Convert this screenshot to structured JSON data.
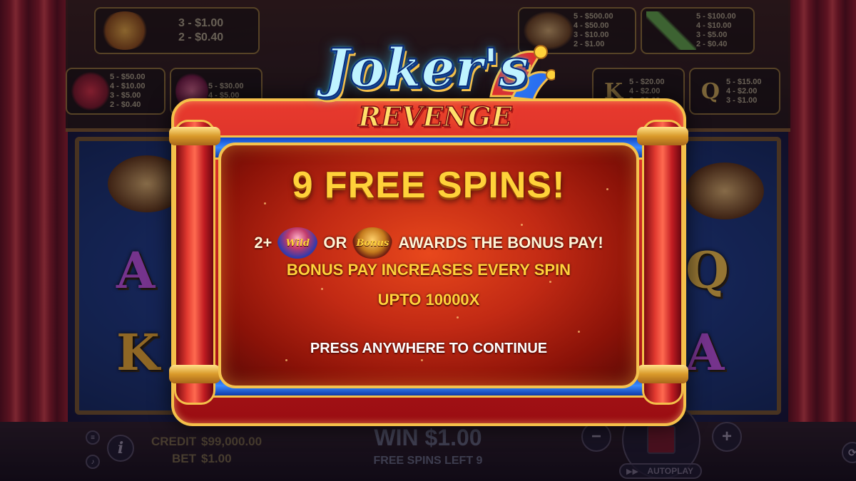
{
  "paytable": {
    "bonus_values": [
      "3 - $1.00",
      "2 - $0.40"
    ],
    "chicken_values": [
      "5 - $500.00",
      "4 - $50.00",
      "3 - $10.00",
      "2 - $1.00"
    ],
    "pins_values": [
      "5 - $100.00",
      "4 - $10.00",
      "3 - $5.00",
      "2 - $0.40"
    ],
    "crown_values": [
      "5 - $50.00",
      "4 - $10.00",
      "3 - $5.00",
      "2 - $0.40"
    ],
    "gem_values": [
      "5 - $30.00",
      "4 - $5.00"
    ],
    "k_values": [
      "5 - $20.00",
      "4 - $2.00",
      "3 - $0.60"
    ],
    "q_values": [
      "5 - $15.00",
      "4 - $2.00",
      "3 - $1.00"
    ],
    "k_letter": "K",
    "q_letter": "Q",
    "bonus_label": "Bonus",
    "wild_label": "Wild"
  },
  "reels": {
    "left_a": "A",
    "left_k": "K",
    "right_q": "Q",
    "right_a": "A"
  },
  "logo": {
    "main": "Joker's",
    "sub": "REVENGE"
  },
  "popup": {
    "title": "9 FREE SPINS!",
    "line1_prefix": "2+",
    "line1_or": "OR",
    "line1_suffix": "AWARDS THE BONUS PAY!",
    "wild_icon_label": "Wild",
    "bonus_icon_label": "Bonus",
    "line2": "BONUS PAY INCREASES EVERY SPIN",
    "line3": "UPTO 10000X",
    "press": "PRESS ANYWHERE TO CONTINUE"
  },
  "bottom": {
    "credit_label": "CREDIT",
    "credit_value": "$99,000.00",
    "bet_label": "BET",
    "bet_value": "$1.00",
    "win_text": "WIN $1.00",
    "free_spins_left": "FREE SPINS LEFT 9",
    "autoplay": "AUTOPLAY",
    "info_icon": "i",
    "minus": "−",
    "plus": "+"
  },
  "colors": {
    "title_gold": "#ffd23a",
    "frame_red": "#c11c22",
    "band_blue": "#2a6ff0",
    "gold_trim": "#f5c04a"
  }
}
